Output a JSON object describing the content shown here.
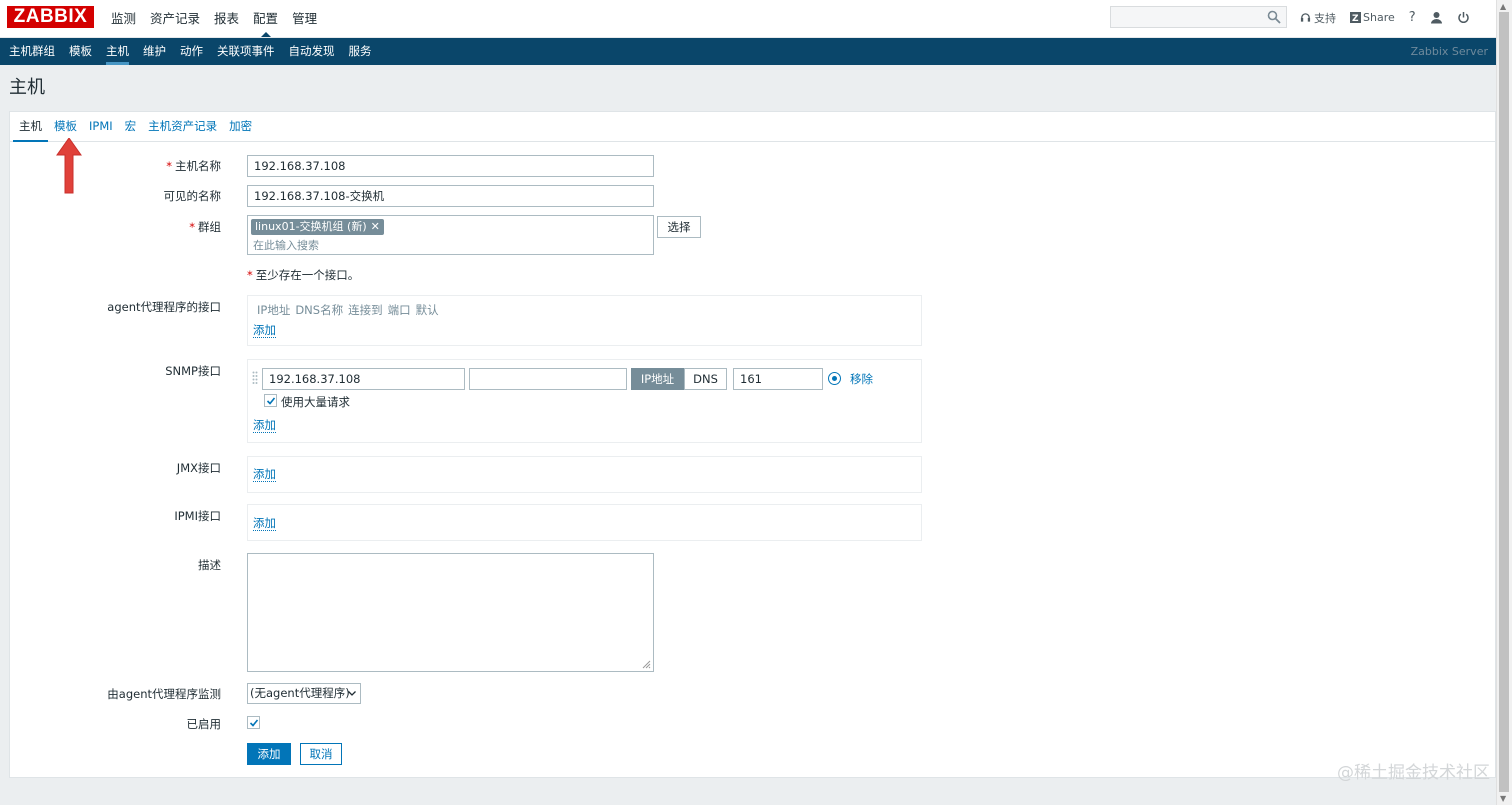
{
  "topbar": {
    "logo": "ZABBIX",
    "nav": [
      "监测",
      "资产记录",
      "报表",
      "配置",
      "管理"
    ],
    "active_nav": "配置",
    "support": "支持",
    "share": "Share",
    "help": "?"
  },
  "subnav": {
    "items": [
      "主机群组",
      "模板",
      "主机",
      "维护",
      "动作",
      "关联项事件",
      "自动发现",
      "服务"
    ],
    "active": "主机",
    "server": "Zabbix Server"
  },
  "page_title": "主机",
  "tabs": [
    "主机",
    "模板",
    "IPMI",
    "宏",
    "主机资产记录",
    "加密"
  ],
  "form": {
    "host_name_label": "主机名称",
    "host_name_value": "192.168.37.108",
    "visible_name_label": "可见的名称",
    "visible_name_value": "192.168.37.108-交换机",
    "groups_label": "群组",
    "group_chip": "linux01-交换机组 (新)",
    "group_placeholder": "在此输入搜索",
    "select_button": "选择",
    "interface_note": "至少存在一个接口。",
    "agent_label": "agent代理程序的接口",
    "agent_headers": [
      "IP地址",
      "DNS名称",
      "连接到",
      "端口",
      "默认"
    ],
    "add_link": "添加",
    "snmp_label": "SNMP接口",
    "snmp_ip": "192.168.37.108",
    "snmp_dns": "",
    "snmp_connect_ip": "IP地址",
    "snmp_connect_dns": "DNS",
    "snmp_port": "161",
    "remove_link": "移除",
    "bulk_label": "使用大量请求",
    "jmx_label": "JMX接口",
    "ipmi_label": "IPMI接口",
    "desc_label": "描述",
    "proxy_label": "由agent代理程序监测",
    "proxy_value": "(无agent代理程序)",
    "enabled_label": "已启用",
    "submit": "添加",
    "cancel": "取消"
  },
  "watermark": "@稀土掘金技术社区",
  "colors": {
    "brand": "#d40000",
    "nav": "#0a466a",
    "link": "#0275b8"
  }
}
